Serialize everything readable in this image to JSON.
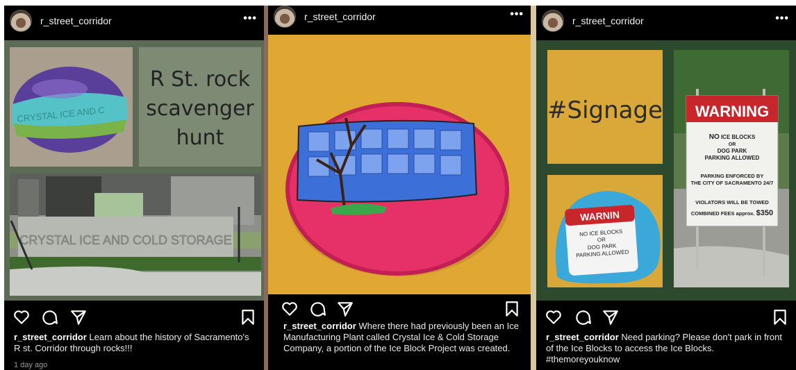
{
  "posts": [
    {
      "username": "r_street_corridor",
      "more": "•••",
      "caption_user": "r_street_corridor",
      "caption_text": " Learn about the history of Sacramento's R st. Corridor through rocks!!!",
      "time": "1 day ago",
      "tile_text": [
        "R St. rock",
        "scavenger",
        "hunt"
      ],
      "rock_text": "CRYSTAL ICE AND C",
      "sign_text": "CRYSTAL ICE AND COLD STORAGE"
    },
    {
      "username": "r_street_corridor",
      "more": "•••",
      "caption_user": "r_street_corridor",
      "caption_text": " Where there had previously been an Ice Manufacturing Plant called Crystal Ice & Cold Storage Company, a portion of the Ice Block Project was created."
    },
    {
      "username": "r_street_corridor",
      "more": "•••",
      "caption_user": "r_street_corridor",
      "caption_text": " Need parking? Please don't park in front of the Ice Blocks to access the Ice Blocks. #themoreyouknow",
      "tile_text": "#Signage",
      "rock_text": {
        "title": "WARNIN",
        "lines": [
          "NO ICE BLOCKS",
          "OR",
          "DOG PARK",
          "PARKING ALLOWED"
        ]
      },
      "warning_sign": {
        "title": "WARNING",
        "line1a": "NO",
        "line1b": " ICE BLOCKS",
        "line2": "OR",
        "line3": "DOG PARK",
        "line4": "PARKING ALLOWED",
        "line5": "PARKING ENFORCED BY",
        "line6": "THE CITY OF SACRAMENTO 24/7",
        "line7": "VIOLATORS WILL BE TOWED",
        "line8a": "COMBINED FEES approx. ",
        "line8b": "$350"
      }
    }
  ],
  "colors": {
    "post_bg": "#000000",
    "collage_bg": "#5b6b55",
    "tile_green": "#7d8b75",
    "mustard": "#d9a838",
    "rock_pink": "#e63168",
    "sign_red": "#c8262b",
    "rock_teal": "#3aa8d8",
    "dark_green": "#2e4a2e"
  },
  "icons": [
    "heart-icon",
    "comment-icon",
    "share-icon",
    "bookmark-icon",
    "more-icon"
  ]
}
